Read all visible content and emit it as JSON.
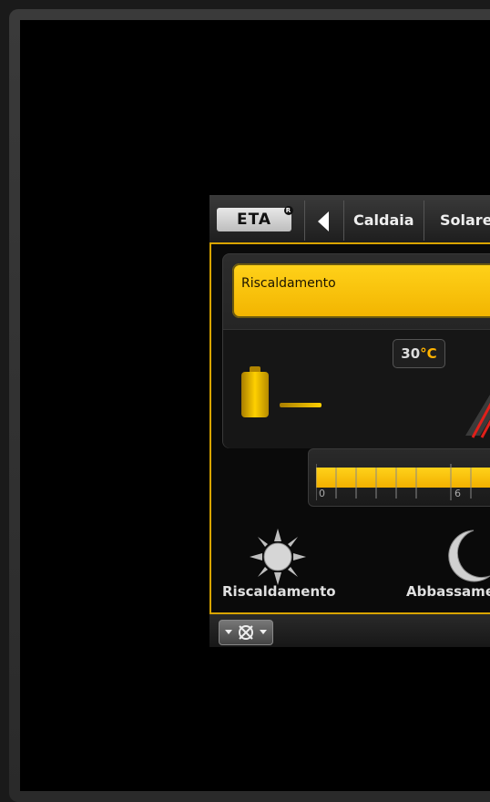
{
  "header": {
    "logo_text": "ETA",
    "tabs": [
      {
        "label": "Caldaia"
      },
      {
        "label": "Solare"
      }
    ]
  },
  "main": {
    "section_title": "Riscaldamento",
    "temperature_value": "30",
    "temperature_unit": "°C",
    "timeline": {
      "tick_labels": [
        "0",
        "6"
      ]
    },
    "modes": [
      {
        "label": "Riscaldamento",
        "icon": "sun-icon"
      },
      {
        "label": "Abbassame",
        "icon": "moon-icon"
      }
    ]
  },
  "colors": {
    "accent": "#ffc400",
    "background": "#000000"
  }
}
